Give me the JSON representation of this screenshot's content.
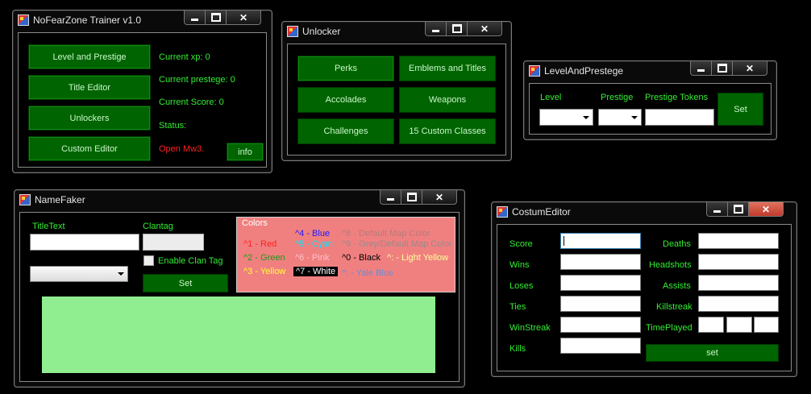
{
  "windows": {
    "trainer": {
      "title": "NoFearZone Trainer v1.0",
      "buttons": {
        "level": "Level and Prestige",
        "title_editor": "Title Editor",
        "unlockers": "Unlockers",
        "custom_editor": "Custom Editor",
        "info": "info"
      },
      "labels": {
        "xp": "Current xp: 0",
        "prestige": "Current prestege: 0",
        "score": "Current Score: 0",
        "status": "Status:",
        "open": "Open Mw3."
      }
    },
    "unlocker": {
      "title": "Unlocker",
      "buttons": {
        "perks": "Perks",
        "emblems": "Emblems and Titles",
        "accolades": "Accolades",
        "weapons": "Weapons",
        "challenges": "Challenges",
        "classes": "15 Custom Classes"
      }
    },
    "level": {
      "title": "LevelAndPrestege",
      "labels": {
        "level": "Level",
        "prestige": "Prestige",
        "tokens": "Prestige Tokens"
      },
      "buttons": {
        "set": "Set"
      }
    },
    "namefaker": {
      "title": "NameFaker",
      "labels": {
        "titletext": "TitleText",
        "clantag": "Clantag",
        "enable": "Enable Clan Tag",
        "colors": "Colors"
      },
      "buttons": {
        "set": "Set"
      },
      "colors": {
        "c1": "^1 - Red",
        "c2": "^2 - Green",
        "c3": "^3 - Yellow",
        "c4": "^4 - Blue",
        "c5": "^5 - Cyan",
        "c6": "^6 - Pink",
        "c7": "^7 - White",
        "c8": "^8 - Default Map Color",
        "c9": "^9 - Grey/Default Map Color",
        "c0": "^0 - Black",
        "cl1": "^: - Light Yellow",
        "cl2": "^; - Yale Blue"
      }
    },
    "costum": {
      "title": "CostumEditor",
      "labels": {
        "score": "Score",
        "wins": "Wins",
        "loses": "Loses",
        "ties": "Ties",
        "winstreak": "WinStreak",
        "kills": "Kills",
        "deaths": "Deaths",
        "headshots": "Headshots",
        "assists": "Assists",
        "killstreak": "Killstreak",
        "timeplayed": "TimePlayed"
      },
      "buttons": {
        "set": "set"
      }
    }
  },
  "colors": {
    "button_green": "#006400",
    "label_green": "#33ee33",
    "status_red": "#ff2020",
    "colors_panel": "#f08080",
    "output_panel": "#90ee90"
  }
}
